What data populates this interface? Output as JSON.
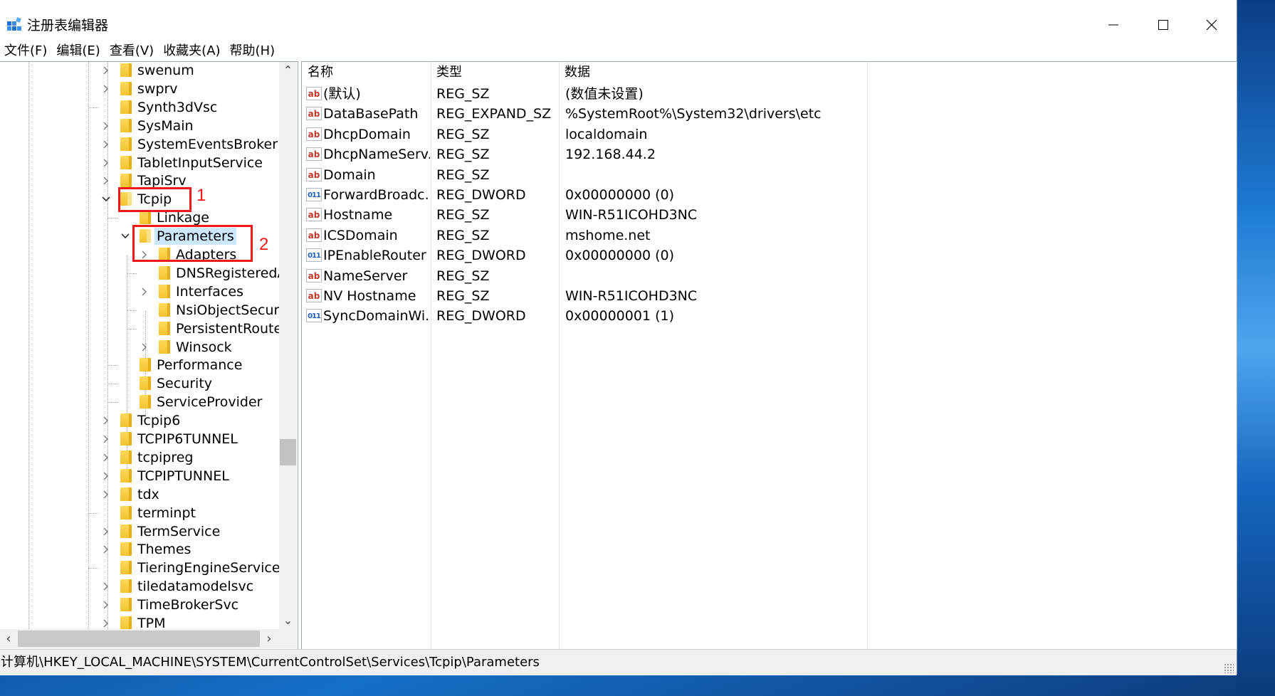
{
  "window": {
    "title": "注册表编辑器",
    "icons": {
      "app": "registry-editor-icon",
      "minimize": "minimize-icon",
      "maximize": "maximize-icon",
      "close": "close-icon"
    }
  },
  "menu": [
    "文件(F)",
    "编辑(E)",
    "查看(V)",
    "收藏夹(A)",
    "帮助(H)"
  ],
  "tree": {
    "items": [
      {
        "label": "swenum",
        "level": 0,
        "expander": "collapsed"
      },
      {
        "label": "swprv",
        "level": 0,
        "expander": "collapsed"
      },
      {
        "label": "Synth3dVsc",
        "level": 0,
        "expander": "none"
      },
      {
        "label": "SysMain",
        "level": 0,
        "expander": "collapsed"
      },
      {
        "label": "SystemEventsBroker",
        "level": 0,
        "expander": "collapsed"
      },
      {
        "label": "TabletInputService",
        "level": 0,
        "expander": "collapsed"
      },
      {
        "label": "TapiSrv",
        "level": 0,
        "expander": "collapsed"
      },
      {
        "label": "Tcpip",
        "level": 0,
        "expander": "expanded"
      },
      {
        "label": "Linkage",
        "level": 1,
        "expander": "none"
      },
      {
        "label": "Parameters",
        "level": 1,
        "expander": "expanded",
        "selected": true
      },
      {
        "label": "Adapters",
        "level": 2,
        "expander": "collapsed"
      },
      {
        "label": "DNSRegisteredA",
        "level": 2,
        "expander": "none"
      },
      {
        "label": "Interfaces",
        "level": 2,
        "expander": "collapsed"
      },
      {
        "label": "NsiObjectSecurit",
        "level": 2,
        "expander": "none"
      },
      {
        "label": "PersistentRoutes",
        "level": 2,
        "expander": "none"
      },
      {
        "label": "Winsock",
        "level": 2,
        "expander": "collapsed"
      },
      {
        "label": "Performance",
        "level": 1,
        "expander": "none"
      },
      {
        "label": "Security",
        "level": 1,
        "expander": "none"
      },
      {
        "label": "ServiceProvider",
        "level": 1,
        "expander": "none"
      },
      {
        "label": "Tcpip6",
        "level": 0,
        "expander": "collapsed"
      },
      {
        "label": "TCPIP6TUNNEL",
        "level": 0,
        "expander": "collapsed"
      },
      {
        "label": "tcpipreg",
        "level": 0,
        "expander": "collapsed"
      },
      {
        "label": "TCPIPTUNNEL",
        "level": 0,
        "expander": "collapsed"
      },
      {
        "label": "tdx",
        "level": 0,
        "expander": "collapsed"
      },
      {
        "label": "terminpt",
        "level": 0,
        "expander": "none"
      },
      {
        "label": "TermService",
        "level": 0,
        "expander": "collapsed"
      },
      {
        "label": "Themes",
        "level": 0,
        "expander": "collapsed"
      },
      {
        "label": "TieringEngineService",
        "level": 0,
        "expander": "none"
      },
      {
        "label": "tiledatamodelsvc",
        "level": 0,
        "expander": "collapsed"
      },
      {
        "label": "TimeBrokerSvc",
        "level": 0,
        "expander": "collapsed"
      },
      {
        "label": "TPM",
        "level": 0,
        "expander": "collapsed"
      }
    ]
  },
  "values": {
    "columns": [
      "名称",
      "类型",
      "数据"
    ],
    "rows": [
      {
        "icon": "ab",
        "name": "(默认)",
        "type": "REG_SZ",
        "data": "(数值未设置)"
      },
      {
        "icon": "ab",
        "name": "DataBasePath",
        "type": "REG_EXPAND_SZ",
        "data": "%SystemRoot%\\System32\\drivers\\etc"
      },
      {
        "icon": "ab",
        "name": "DhcpDomain",
        "type": "REG_SZ",
        "data": "localdomain"
      },
      {
        "icon": "ab",
        "name": "DhcpNameServ...",
        "type": "REG_SZ",
        "data": "192.168.44.2"
      },
      {
        "icon": "ab",
        "name": "Domain",
        "type": "REG_SZ",
        "data": ""
      },
      {
        "icon": "bin",
        "name": "ForwardBroadc...",
        "type": "REG_DWORD",
        "data": "0x00000000 (0)"
      },
      {
        "icon": "ab",
        "name": "Hostname",
        "type": "REG_SZ",
        "data": "WIN-R51ICOHD3NC"
      },
      {
        "icon": "ab",
        "name": "ICSDomain",
        "type": "REG_SZ",
        "data": "mshome.net"
      },
      {
        "icon": "bin",
        "name": "IPEnableRouter",
        "type": "REG_DWORD",
        "data": "0x00000000 (0)"
      },
      {
        "icon": "ab",
        "name": "NameServer",
        "type": "REG_SZ",
        "data": ""
      },
      {
        "icon": "ab",
        "name": "NV Hostname",
        "type": "REG_SZ",
        "data": "WIN-R51ICOHD3NC"
      },
      {
        "icon": "bin",
        "name": "SyncDomainWi...",
        "type": "REG_DWORD",
        "data": "0x00000001 (1)"
      }
    ]
  },
  "status": {
    "path": "计算机\\HKEY_LOCAL_MACHINE\\SYSTEM\\CurrentControlSet\\Services\\Tcpip\\Parameters"
  },
  "annotations": [
    "1",
    "2"
  ],
  "icon_glyphs": {
    "ab": "ab",
    "bin": "011"
  },
  "colors": {
    "annotation": "#f01818",
    "selection": "#cce8ff"
  }
}
